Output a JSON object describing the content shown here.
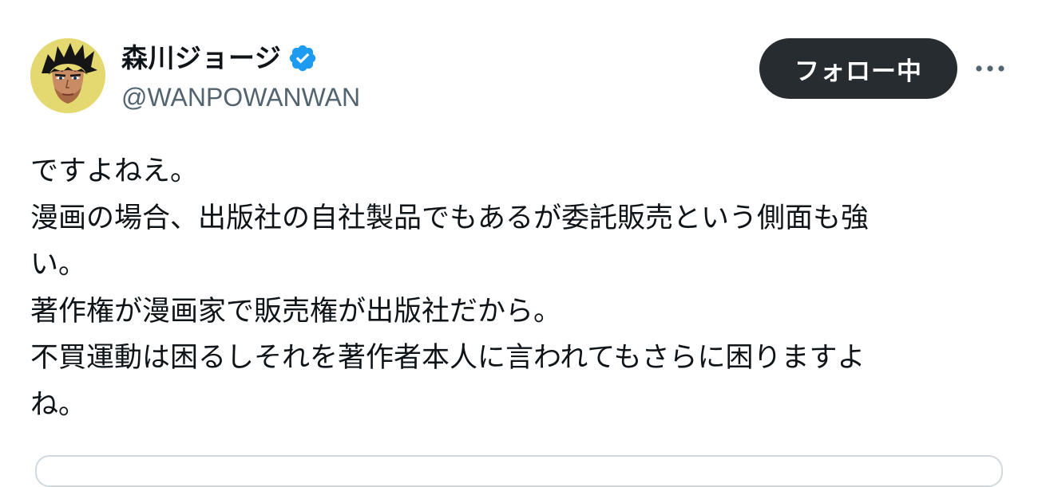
{
  "author": {
    "display_name": "森川ジョージ",
    "handle": "@WANPOWANWAN",
    "verified": true,
    "avatar_icon": "avatar-icon"
  },
  "actions": {
    "follow_label": "フォロー中",
    "more_icon": "more-horizontal-icon"
  },
  "tweet": {
    "lines": [
      "ですよねえ。",
      "漫画の場合、出版社の自社製品でもあるが委託販売という側面も強",
      "い。",
      "著作権が漫画家で販売権が出版社だから。",
      "不買運動は困るしそれを著作者本人に言われてもさらに困りますよ",
      "ね。"
    ]
  },
  "colors": {
    "text_primary": "#0f1419",
    "text_secondary": "#536471",
    "verified_blue": "#1d9bf0",
    "follow_button_bg": "#272c30",
    "card_border": "#cfd9de"
  }
}
